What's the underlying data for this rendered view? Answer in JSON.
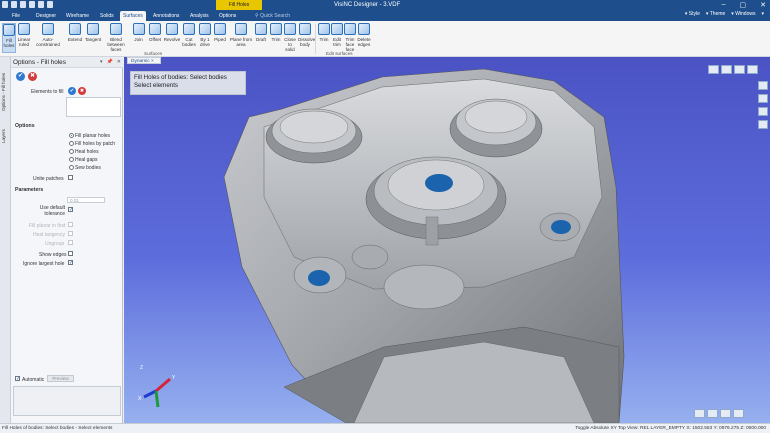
{
  "window": {
    "title": "VisiNC Designer - 3.VDF",
    "context_tab": "Fill Holes",
    "minimize": "–",
    "maximize": "▢",
    "close": "✕"
  },
  "tabs": [
    "File",
    "Designer",
    "Wireframe",
    "Solids",
    "Surfaces",
    "Annotations",
    "Analysis",
    "Options"
  ],
  "active_tab": "Surfaces",
  "search_placeholder": "Quick Search",
  "right_menu": [
    "▾ Style",
    "▾ Theme",
    "▾ Windows",
    "▾"
  ],
  "ribbon": {
    "buttons": [
      {
        "label": "Fill holes"
      },
      {
        "label": "Linear ruled"
      },
      {
        "label": "Auto-constrained"
      },
      {
        "label": "Extend"
      },
      {
        "label": "Tangent"
      },
      {
        "label": "Blend between faces"
      },
      {
        "label": "Join"
      },
      {
        "label": "Offset"
      },
      {
        "label": "Revolve"
      },
      {
        "label": "Cut bodies"
      },
      {
        "label": "By 1 drive"
      },
      {
        "label": "Piped"
      },
      {
        "label": "Plane from area"
      },
      {
        "label": "Draft"
      },
      {
        "label": "Trim"
      },
      {
        "label": "Close to solid"
      },
      {
        "label": "Dissolve body"
      },
      {
        "label": "Trim"
      },
      {
        "label": "Edit trim"
      },
      {
        "label": "Trim face face"
      },
      {
        "label": "Delete edges"
      }
    ],
    "group_surfaces": "Surfaces",
    "group_edit": "Edit surfaces"
  },
  "left_strip": [
    "Options - Fill holes",
    "Layers"
  ],
  "panel": {
    "title": "Options - Fill holes",
    "pin": "📌",
    "close": "✕",
    "dropdown": "▾",
    "elements_label": "Elements to fill",
    "options_title": "Options",
    "radio_options": [
      "Fill planar holes",
      "Fill holes by patch",
      "Heal holes",
      "Heal gaps",
      "Sew bodies"
    ],
    "unite_label": "Unite patches",
    "params_title": "Parameters",
    "tolerance_value": "0.01",
    "default_tol_label": "Use default tolerance",
    "disabled_labels": [
      "Fill planar in first",
      "Heal tangency",
      "Ungroup"
    ],
    "show_edges_label": "Show edges",
    "ignore_largest_label": "Ignore largest hole",
    "automatic_label": "Automatic",
    "preview_label": "Preview"
  },
  "viewport": {
    "tab": "Dynamic",
    "hint_line1": "Fill Holes of bodies: Select bodies",
    "hint_line2": "Select elements",
    "model_color": "#9a9ca0",
    "hole_color": "#1b63ad"
  },
  "status": {
    "message": "Fill Holes of bodies: Select bodies - Select elements",
    "right": "Toggle  Absolute XY Top  View: REL  LAYER_EMPTY  X: 1502.553  Y: 0976.275  Z: 0000.000"
  }
}
